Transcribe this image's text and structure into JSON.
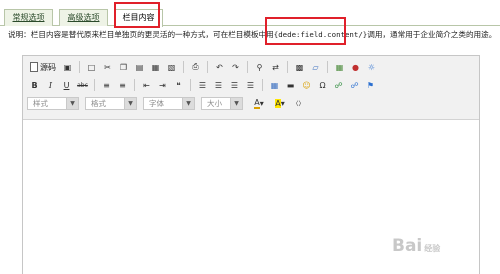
{
  "tabs": [
    {
      "label": "常规选项",
      "active": false
    },
    {
      "label": "高级选项",
      "active": false
    },
    {
      "label": "栏目内容",
      "active": true
    }
  ],
  "description": {
    "prefix": "说明：栏目内容是替代原来栏目单独页的更灵活的一种方式，可在栏目模板中用",
    "code": "{dede:field.content/}",
    "suffix": "调用，通常用于企业简介之类的用途。"
  },
  "toolbar": {
    "source_label": "源码",
    "style_placeholder": "样式",
    "format_placeholder": "格式",
    "font_placeholder": "字体",
    "size_placeholder": "大小",
    "text_color_letter": "A",
    "bg_color_letter": "A",
    "bold": "B",
    "italic": "I",
    "underline": "U",
    "strike": "abc"
  },
  "watermark": {
    "brand": "Bai",
    "suffix": "经验"
  },
  "highlight_color": "#e0202a",
  "accent_color": "#eef3e6"
}
